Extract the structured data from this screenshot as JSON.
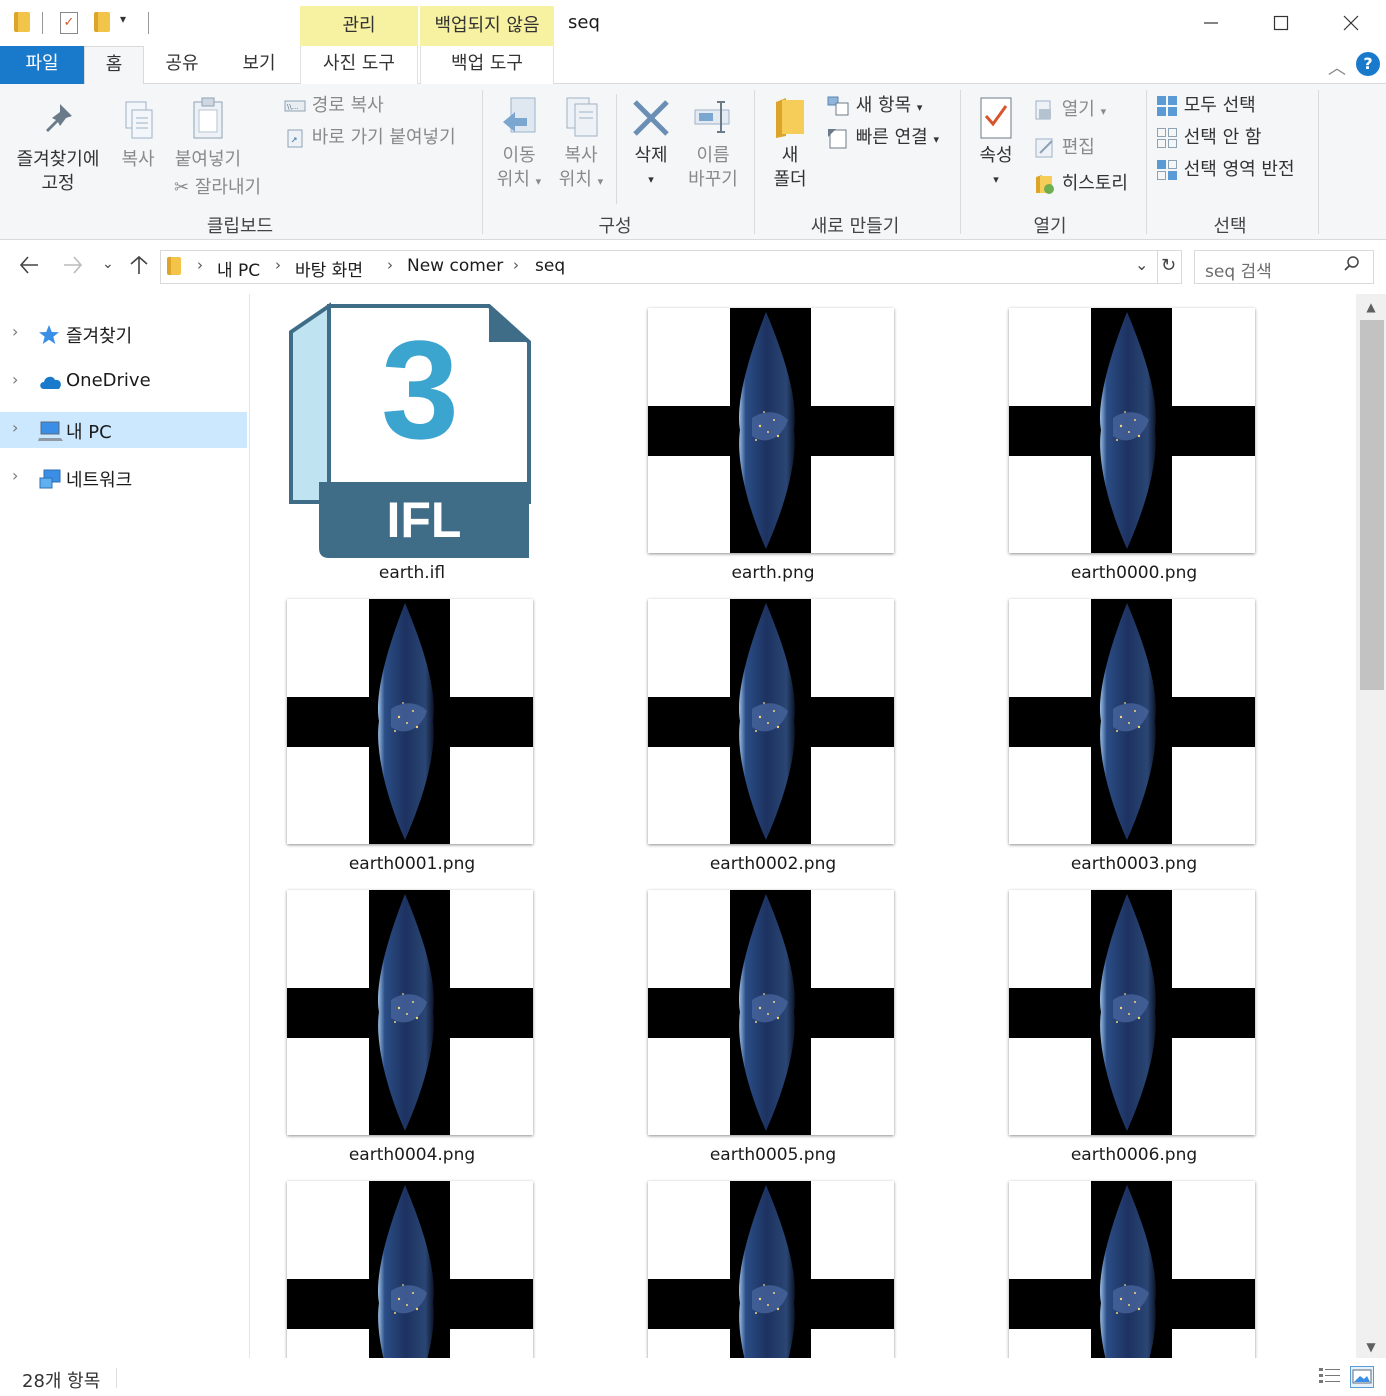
{
  "window": {
    "title": "seq",
    "minimize_icon": "minimize-icon",
    "maximize_icon": "maximize-icon",
    "close_icon": "close-icon"
  },
  "context_tabs": {
    "manage": "관리",
    "not_backed_up": "백업되지 않음"
  },
  "ribbon_tabs": {
    "file": "파일",
    "home": "홈",
    "share": "공유",
    "view": "보기",
    "picture_tools": "사진 도구",
    "backup_tools": "백업 도구"
  },
  "ribbon": {
    "clipboard": {
      "group": "클립보드",
      "pin_line1": "즐겨찾기에",
      "pin_line2": "고정",
      "copy": "복사",
      "paste": "붙여넣기",
      "copy_path": "경로 복사",
      "paste_shortcut": "바로 가기 붙여넣기",
      "cut": "잘라내기"
    },
    "organize": {
      "group": "구성",
      "move_line1": "이동",
      "move_line2": "위치",
      "copyto_line1": "복사",
      "copyto_line2": "위치",
      "delete": "삭제",
      "rename_line1": "이름",
      "rename_line2": "바꾸기"
    },
    "new": {
      "group": "새로 만들기",
      "folder_line1": "새",
      "folder_line2": "폴더",
      "new_item": "새 항목",
      "easy_access": "빠른 연결"
    },
    "open": {
      "group": "열기",
      "properties": "속성",
      "open": "열기",
      "edit": "편집",
      "history": "히스토리"
    },
    "select": {
      "group": "선택",
      "select_all": "모두 선택",
      "select_none": "선택 안 함",
      "invert": "선택 영역 반전"
    }
  },
  "address": {
    "crumbs": [
      "내 PC",
      "바탕 화면",
      "New comer",
      "seq"
    ],
    "search_placeholder": "seq 검색"
  },
  "nav_pane": {
    "items": [
      {
        "label": "즐겨찾기",
        "icon": "star-icon"
      },
      {
        "label": "OneDrive",
        "icon": "cloud-icon"
      },
      {
        "label": "내 PC",
        "icon": "computer-icon"
      },
      {
        "label": "네트워크",
        "icon": "network-icon"
      }
    ]
  },
  "files": [
    {
      "name": "earth.ifl",
      "kind": "ifl"
    },
    {
      "name": "earth.png",
      "kind": "png"
    },
    {
      "name": "earth0000.png",
      "kind": "png"
    },
    {
      "name": "earth0001.png",
      "kind": "png"
    },
    {
      "name": "earth0002.png",
      "kind": "png"
    },
    {
      "name": "earth0003.png",
      "kind": "png"
    },
    {
      "name": "earth0004.png",
      "kind": "png"
    },
    {
      "name": "earth0005.png",
      "kind": "png"
    },
    {
      "name": "earth0006.png",
      "kind": "png"
    },
    {
      "name": "",
      "kind": "png"
    },
    {
      "name": "",
      "kind": "png"
    },
    {
      "name": "",
      "kind": "png"
    }
  ],
  "ifl_icon": {
    "number": "3",
    "label": "IFL"
  },
  "status": {
    "item_count": "28개 항목"
  },
  "colors": {
    "accent": "#1979ca",
    "context_tab": "#f7f1a2",
    "selection": "#cce8ff",
    "ifl_dark": "#3f6d88",
    "ifl_light": "#3ba4cf"
  }
}
